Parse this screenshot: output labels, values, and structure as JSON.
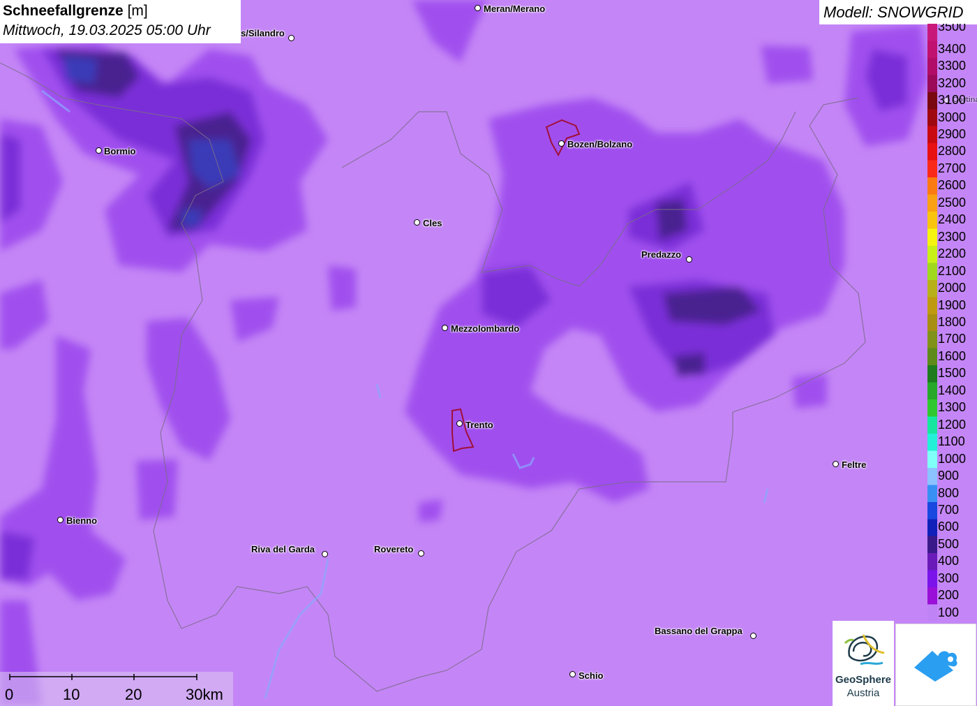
{
  "title": {
    "param": "Schneefallgrenze",
    "unit": "[m]",
    "datetime": "Mittwoch, 19.03.2025 05:00 Uhr"
  },
  "model_label": "Modell: SNOWGRID",
  "legend": {
    "values": [
      "3500",
      "3400",
      "3300",
      "3200",
      "3100",
      "3000",
      "2900",
      "2800",
      "2700",
      "2600",
      "2500",
      "2400",
      "2300",
      "2200",
      "2100",
      "2000",
      "1900",
      "1800",
      "1700",
      "1600",
      "1500",
      "1400",
      "1300",
      "1200",
      "1100",
      "1000",
      "900",
      "800",
      "700",
      "600",
      "500",
      "400",
      "300",
      "200",
      "100"
    ],
    "colors": [
      "#c8197a",
      "#c01070",
      "#b00c68",
      "#9a0a58",
      "#7a0810",
      "#a00810",
      "#c80a10",
      "#e81012",
      "#fa2a1a",
      "#fb7a12",
      "#f9a014",
      "#f8c410",
      "#f4f410",
      "#c8f018",
      "#a0d81e",
      "#b8b018",
      "#bf9a10",
      "#a88e12",
      "#80921a",
      "#5e8a1a",
      "#1e7c1e",
      "#28a82a",
      "#30c830",
      "#16e6a0",
      "#24f0d8",
      "#80fff8",
      "#8cc2ff",
      "#3890f4",
      "#1848e0",
      "#1020b8",
      "#3a1a8a",
      "#6a1ab8",
      "#7a14ea",
      "#9a10d8",
      "#c083f6"
    ]
  },
  "map": {
    "base_color": "#c486f6",
    "low_color": "#a050ee",
    "mid_color": "#7a2fd8",
    "high_color": "#4a2090",
    "blue_color": "#3b3ab8"
  },
  "cities": [
    {
      "name": "Meran/Merano",
      "label_side": "right"
    },
    {
      "name": "s/Silandro",
      "label_side": "left"
    },
    {
      "name": "Bormio",
      "label_side": "right"
    },
    {
      "name": "Bozen/Bolzano",
      "label_side": "right"
    },
    {
      "name": "Cles",
      "label_side": "right"
    },
    {
      "name": "Predazzo",
      "label_side": "left"
    },
    {
      "name": "Mezzolombardo",
      "label_side": "right"
    },
    {
      "name": "Trento",
      "label_side": "right"
    },
    {
      "name": "Feltre",
      "label_side": "right"
    },
    {
      "name": "Bienno",
      "label_side": "right"
    },
    {
      "name": "Riva del Garda",
      "label_side": "left"
    },
    {
      "name": "Rovereto",
      "label_side": "left"
    },
    {
      "name": "Bassano del Grappa",
      "label_side": "left"
    },
    {
      "name": "Schio",
      "label_side": "right"
    },
    {
      "name": "Cortina",
      "label_side": "right"
    }
  ],
  "scale": {
    "labels": [
      "0",
      "10",
      "20",
      "30km"
    ]
  },
  "logos": {
    "geosphere_line1": "GeoSphere",
    "geosphere_line2": "Austria"
  }
}
